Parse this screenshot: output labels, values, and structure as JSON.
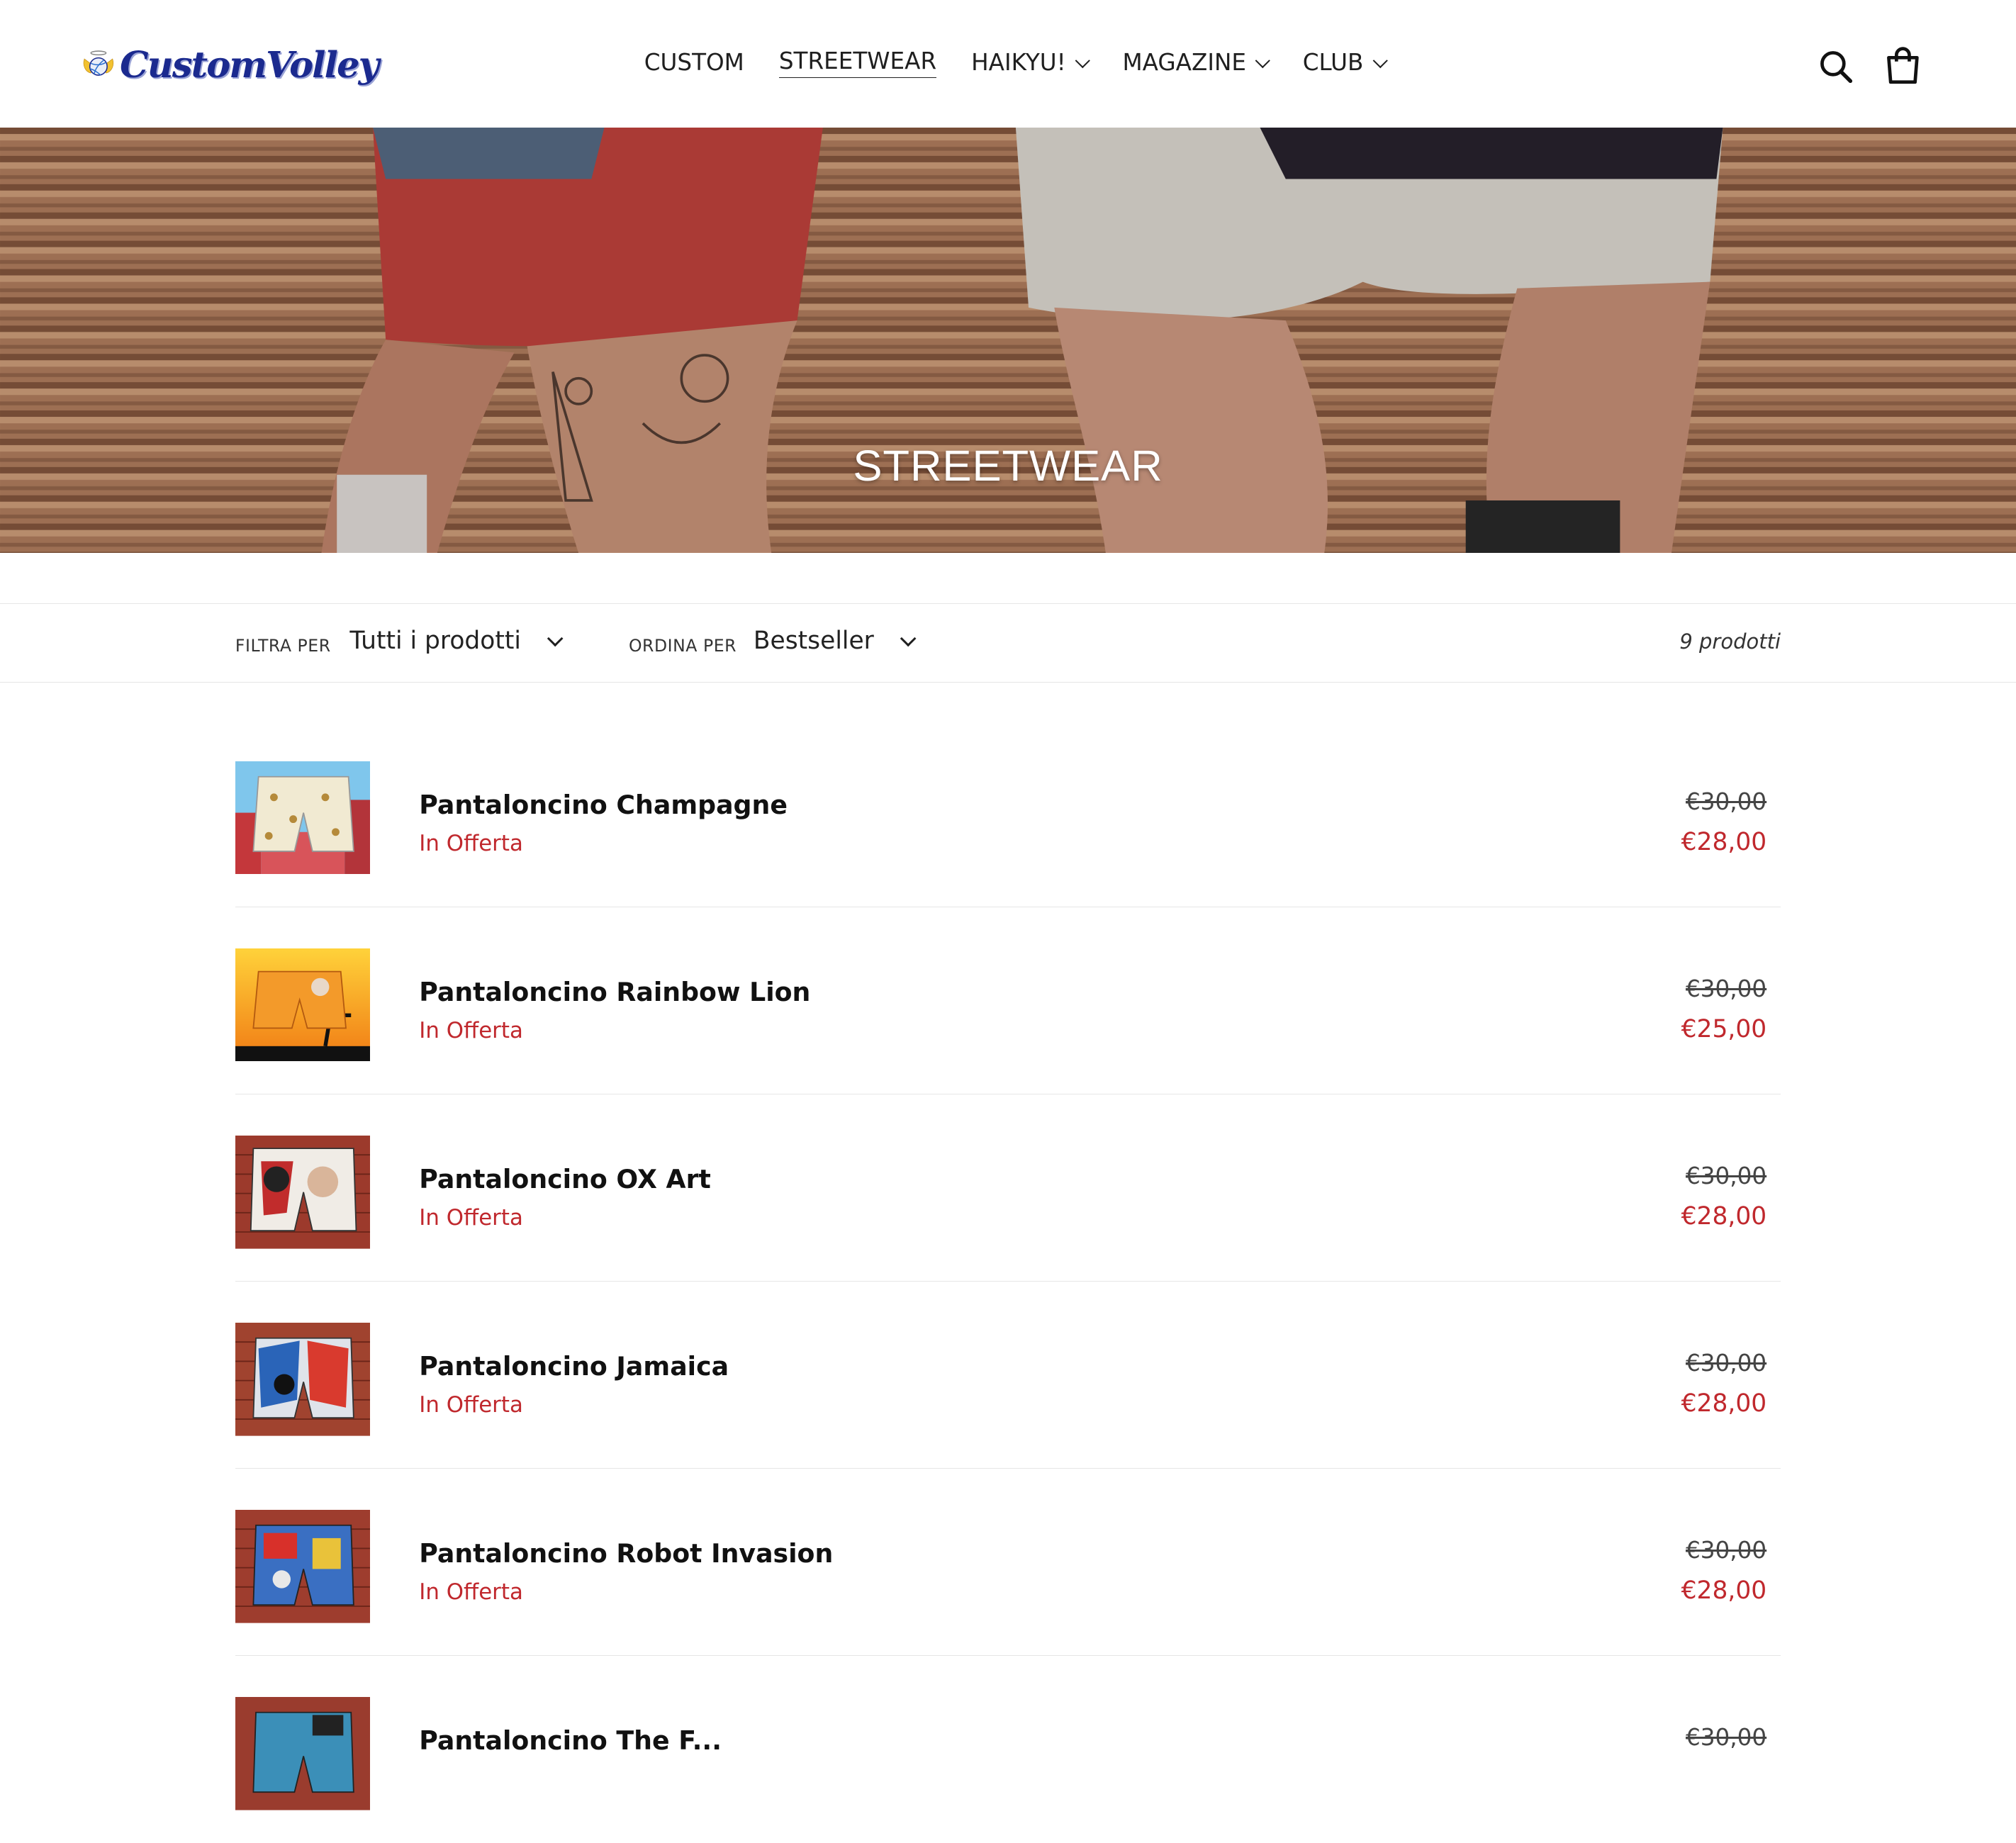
{
  "brand": {
    "name": "CustomVolley"
  },
  "nav": {
    "items": [
      {
        "label": "CUSTOM",
        "has_dropdown": false,
        "active": false
      },
      {
        "label": "STREETWEAR",
        "has_dropdown": false,
        "active": true
      },
      {
        "label": "HAIKYU!",
        "has_dropdown": true,
        "active": false
      },
      {
        "label": "MAGAZINE",
        "has_dropdown": true,
        "active": false
      },
      {
        "label": "CLUB",
        "has_dropdown": true,
        "active": false
      }
    ],
    "icons": [
      "search-icon",
      "cart-icon"
    ]
  },
  "hero": {
    "title": "STREETWEAR"
  },
  "filters": {
    "filter_label": "FILTRA PER",
    "filter_value": "Tutti i prodotti",
    "sort_label": "ORDINA PER",
    "sort_value": "Bestseller",
    "count": "9 prodotti"
  },
  "colors": {
    "sale": "#c0282d",
    "brand_blue": "#1b2a8f"
  },
  "products": [
    {
      "name": "Pantaloncino Champagne",
      "badge": "In Offerta",
      "old_price": "€30,00",
      "price": "€28,00"
    },
    {
      "name": "Pantaloncino Rainbow Lion",
      "badge": "In Offerta",
      "old_price": "€30,00",
      "price": "€25,00"
    },
    {
      "name": "Pantaloncino OX Art",
      "badge": "In Offerta",
      "old_price": "€30,00",
      "price": "€28,00"
    },
    {
      "name": "Pantaloncino Jamaica",
      "badge": "In Offerta",
      "old_price": "€30,00",
      "price": "€28,00"
    },
    {
      "name": "Pantaloncino Robot Invasion",
      "badge": "In Offerta",
      "old_price": "€30,00",
      "price": "€28,00"
    },
    {
      "name": "Pantaloncino The F...",
      "badge": "",
      "old_price": "€30,00",
      "price": ""
    }
  ]
}
